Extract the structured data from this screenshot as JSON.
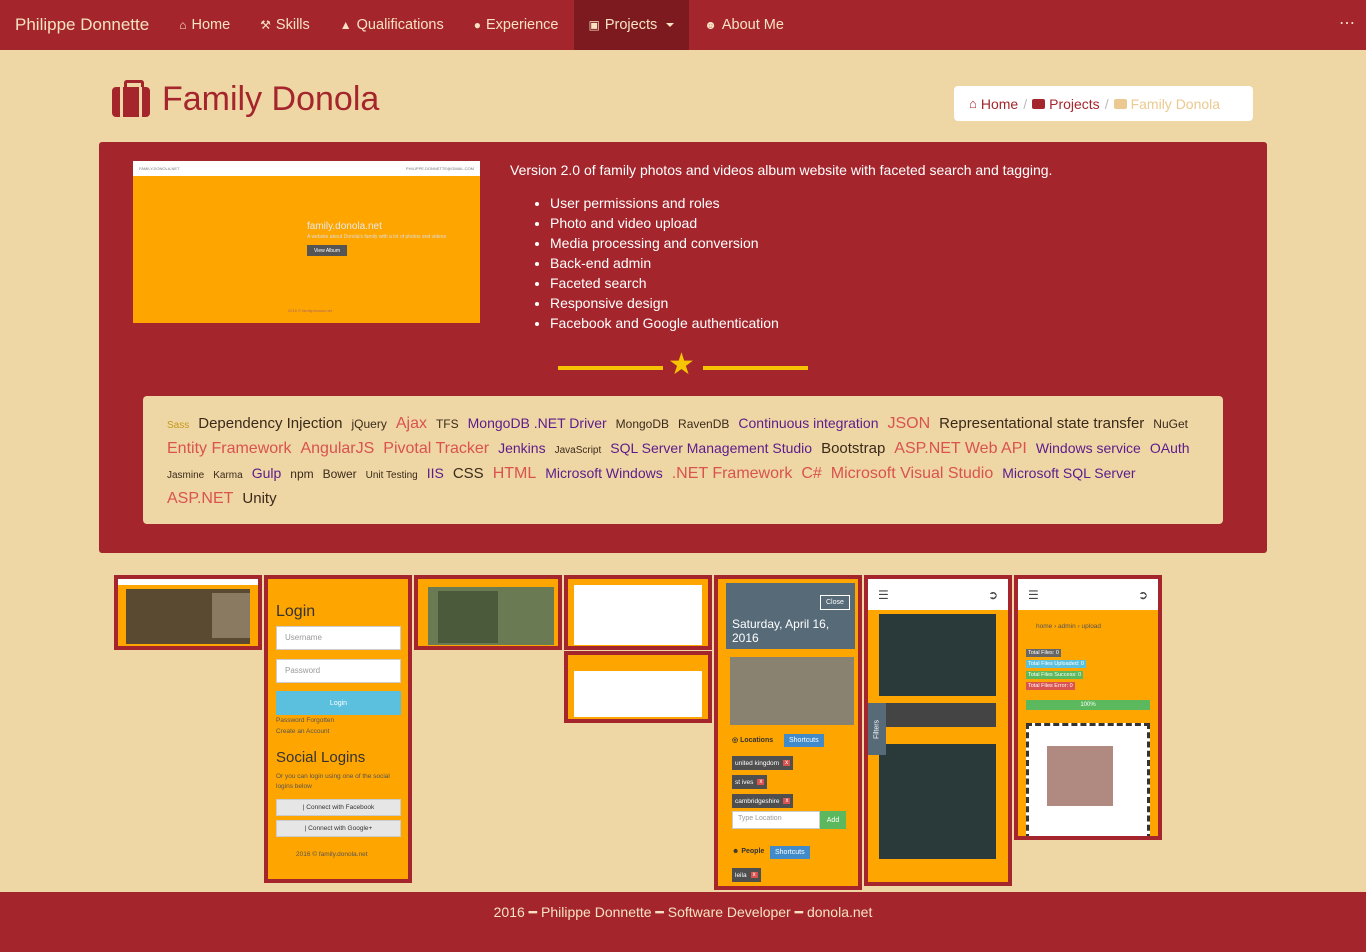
{
  "navbar": {
    "brand": "Philippe Donnette",
    "items": [
      {
        "label": "Home",
        "icon": "home-icon"
      },
      {
        "label": "Skills",
        "icon": "wrench-icon"
      },
      {
        "label": "Qualifications",
        "icon": "graduation-cap-icon"
      },
      {
        "label": "Experience",
        "icon": "lightbulb-icon"
      },
      {
        "label": "Projects",
        "icon": "briefcase-icon",
        "active": true
      },
      {
        "label": "About Me",
        "icon": "user-icon"
      }
    ],
    "more": "⋯"
  },
  "page": {
    "title": "Family Donola"
  },
  "breadcrumb": {
    "home": "Home",
    "projects": "Projects",
    "current": "Family Donola",
    "separator": "/"
  },
  "project": {
    "description": "Version 2.0 of family photos and videos album website with faceted search and tagging.",
    "features": [
      "User permissions and roles",
      "Photo and video upload",
      "Media processing and conversion",
      "Back-end admin",
      "Faceted search",
      "Responsive design",
      "Facebook and Google authentication"
    ],
    "screenshot": {
      "topbar_left": "FAMILY.DONOLA.NET",
      "topbar_right": "PHILIPPE.DONNETTE@GMAIL.COM",
      "title": "family.donola.net",
      "subtitle": "A website about Donola's family with a lot of photos and videos",
      "button": "View Album",
      "footer": "2016 © family.donola.net"
    }
  },
  "tags": [
    {
      "label": "Sass",
      "color": "gold",
      "size": "xs"
    },
    {
      "label": "Dependency Injection",
      "color": "dark",
      "size": "lg"
    },
    {
      "label": "jQuery",
      "color": "dark",
      "size": "sm"
    },
    {
      "label": "Ajax",
      "color": "red",
      "size": "xl"
    },
    {
      "label": "TFS",
      "color": "dark",
      "size": "sm"
    },
    {
      "label": "MongoDB .NET Driver",
      "color": "purple",
      "size": "md"
    },
    {
      "label": "MongoDB",
      "color": "dark",
      "size": "sm"
    },
    {
      "label": "RavenDB",
      "color": "dark",
      "size": "sm"
    },
    {
      "label": "Continuous integration",
      "color": "purple",
      "size": "md"
    },
    {
      "label": "JSON",
      "color": "red",
      "size": "xl"
    },
    {
      "label": "Representational state transfer",
      "color": "dark",
      "size": "lg"
    },
    {
      "label": "NuGet",
      "color": "dark",
      "size": "sm"
    },
    {
      "label": "Entity Framework",
      "color": "red",
      "size": "xl"
    },
    {
      "label": "AngularJS",
      "color": "red",
      "size": "xl"
    },
    {
      "label": "Pivotal Tracker",
      "color": "red",
      "size": "xl"
    },
    {
      "label": "Jenkins",
      "color": "purple",
      "size": "md"
    },
    {
      "label": "JavaScript",
      "color": "dark",
      "size": "xs"
    },
    {
      "label": "SQL Server Management Studio",
      "color": "purple",
      "size": "md"
    },
    {
      "label": "Bootstrap",
      "color": "dark",
      "size": "lg"
    },
    {
      "label": "ASP.NET Web API",
      "color": "red",
      "size": "xl"
    },
    {
      "label": "Windows service",
      "color": "purple",
      "size": "md"
    },
    {
      "label": "OAuth",
      "color": "purple",
      "size": "md"
    },
    {
      "label": "Jasmine",
      "color": "dark",
      "size": "xs"
    },
    {
      "label": "Karma",
      "color": "dark",
      "size": "xs"
    },
    {
      "label": "Gulp",
      "color": "purple",
      "size": "md"
    },
    {
      "label": "npm",
      "color": "dark",
      "size": "sm"
    },
    {
      "label": "Bower",
      "color": "dark",
      "size": "sm"
    },
    {
      "label": "Unit Testing",
      "color": "dark",
      "size": "xs"
    },
    {
      "label": "IIS",
      "color": "purple",
      "size": "md"
    },
    {
      "label": "CSS",
      "color": "dark",
      "size": "lg"
    },
    {
      "label": "HTML",
      "color": "red",
      "size": "xl"
    },
    {
      "label": "Microsoft Windows",
      "color": "purple",
      "size": "md"
    },
    {
      "label": ".NET Framework",
      "color": "red",
      "size": "xl"
    },
    {
      "label": "C#",
      "color": "red",
      "size": "xl"
    },
    {
      "label": "Microsoft Visual Studio",
      "color": "red",
      "size": "xl"
    },
    {
      "label": "Microsoft SQL Server",
      "color": "purple",
      "size": "md"
    },
    {
      "label": "ASP.NET",
      "color": "red",
      "size": "xl"
    },
    {
      "label": "Unity",
      "color": "dark",
      "size": "lg"
    }
  ],
  "thumbs": {
    "login": {
      "title": "Login",
      "username_placeholder": "Username",
      "password_placeholder": "Password",
      "login_button": "Login",
      "forgot": "Password Forgotten",
      "create": "Create an Account",
      "social_title": "Social Logins",
      "social_text": "Or you can login using one of the social logins below",
      "facebook": "| Connect with Facebook",
      "google": "| Connect with Google+",
      "footer": "2016 © family.donola.net"
    },
    "album": {
      "close": "Close",
      "date": "Saturday, April 16, 2016",
      "locations_label": "Locations",
      "shortcuts": "Shortcuts",
      "locations": [
        "united kingdom",
        "st ives",
        "cambridgeshire"
      ],
      "location_placeholder": "Type Location",
      "add": "Add",
      "people_label": "People",
      "people": [
        "leila"
      ]
    },
    "filters": "Filters",
    "upload": {
      "breadcrumb": "home › admin › upload",
      "total_files": "Total Files: 0",
      "uploaded": "Total Files Uploaded: 0",
      "success": "Total Files Success: 0",
      "error": "Total Files Error: 0",
      "progress_label": "100%",
      "progress_value": 1.0
    }
  },
  "footer": {
    "year": "2016",
    "name": "Philippe Donnette",
    "role": "Software Developer",
    "site": "donola.net"
  },
  "colors": {
    "brand_red": "#a4262c",
    "background": "#efd6a5",
    "orange": "#fea500",
    "star": "#f6c403"
  }
}
